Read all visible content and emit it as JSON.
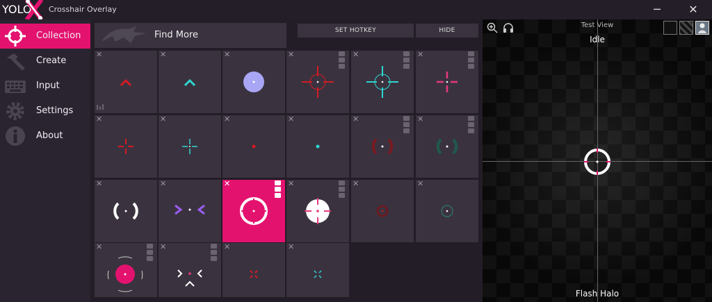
{
  "titlebar": {
    "logo_text": "YOLO",
    "title": "Crosshair Overlay",
    "minimize_label": "─",
    "close_label": "✕"
  },
  "sidebar": {
    "items": [
      {
        "label": "Collection",
        "icon": "crosshair-icon",
        "active": true
      },
      {
        "label": "Create",
        "icon": "hammer-icon",
        "active": false
      },
      {
        "label": "Input",
        "icon": "keyboard-icon",
        "active": false
      },
      {
        "label": "Settings",
        "icon": "gear-icon",
        "active": false
      },
      {
        "label": "About",
        "icon": "info-icon",
        "active": false
      }
    ]
  },
  "toolbar": {
    "find_more": "Find More",
    "set_hotkey": "SET HOTKEY",
    "hide": "HIDE"
  },
  "delete_glyph": "✕",
  "test_view": {
    "title": "Test View",
    "state": "Idle",
    "crosshair_name": "Flash Halo"
  },
  "colors": {
    "accent": "#e4126f",
    "red": "#d41a24",
    "cyan": "#2fd6d0",
    "lavender": "#a9a6f5",
    "purple": "#9b5cf0",
    "green": "#2b8a72",
    "pink": "#e8377f"
  }
}
